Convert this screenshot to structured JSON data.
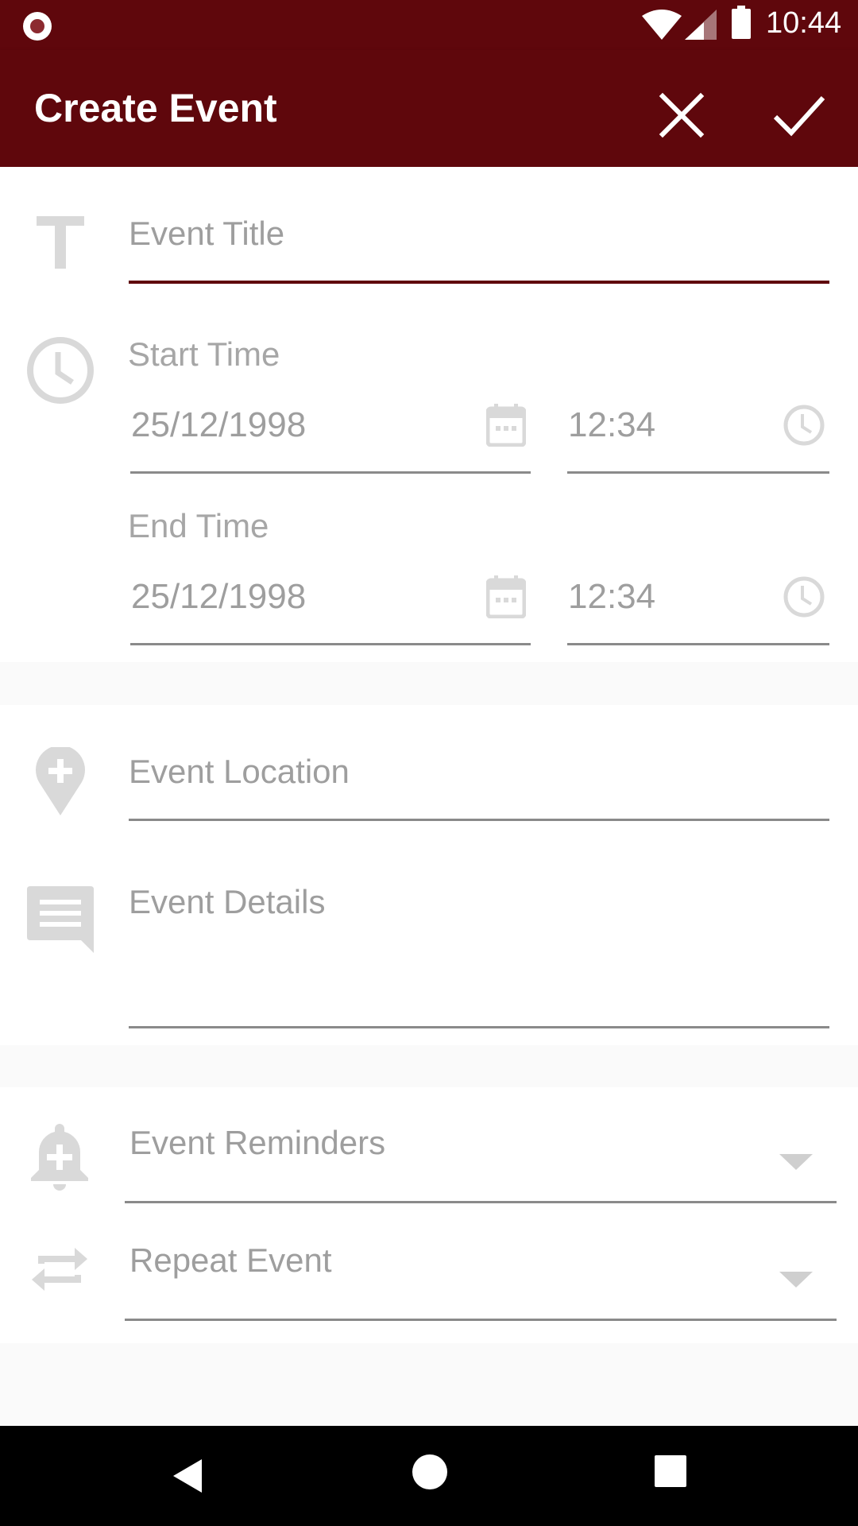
{
  "status_bar": {
    "time": "10:44",
    "icons": [
      "record-indicator-icon",
      "wifi-icon",
      "signal-icon",
      "battery-icon"
    ]
  },
  "app_bar": {
    "title": "Create Event",
    "close_icon": "close-icon",
    "confirm_icon": "check-icon"
  },
  "form": {
    "title": {
      "placeholder": "Event Title",
      "icon": "title-text-icon"
    },
    "start": {
      "label": "Start Time",
      "date": "25/12/1998",
      "time": "12:34"
    },
    "end": {
      "label": "End Time",
      "date": "25/12/1998",
      "time": "12:34"
    },
    "location": {
      "placeholder": "Event Location",
      "icon": "add-location-icon"
    },
    "details": {
      "placeholder": "Event Details",
      "icon": "comment-icon"
    },
    "reminders": {
      "placeholder": "Event Reminders",
      "icon": "add-alarm-bell-icon"
    },
    "repeat": {
      "placeholder": "Repeat Event",
      "icon": "repeat-icon"
    }
  },
  "colors": {
    "primary": "#5f070c",
    "placeholder": "#9e9e9e",
    "icon": "#d9d9d9"
  },
  "nav_bar": {
    "icons": [
      "back-icon",
      "home-icon",
      "recents-icon"
    ]
  }
}
